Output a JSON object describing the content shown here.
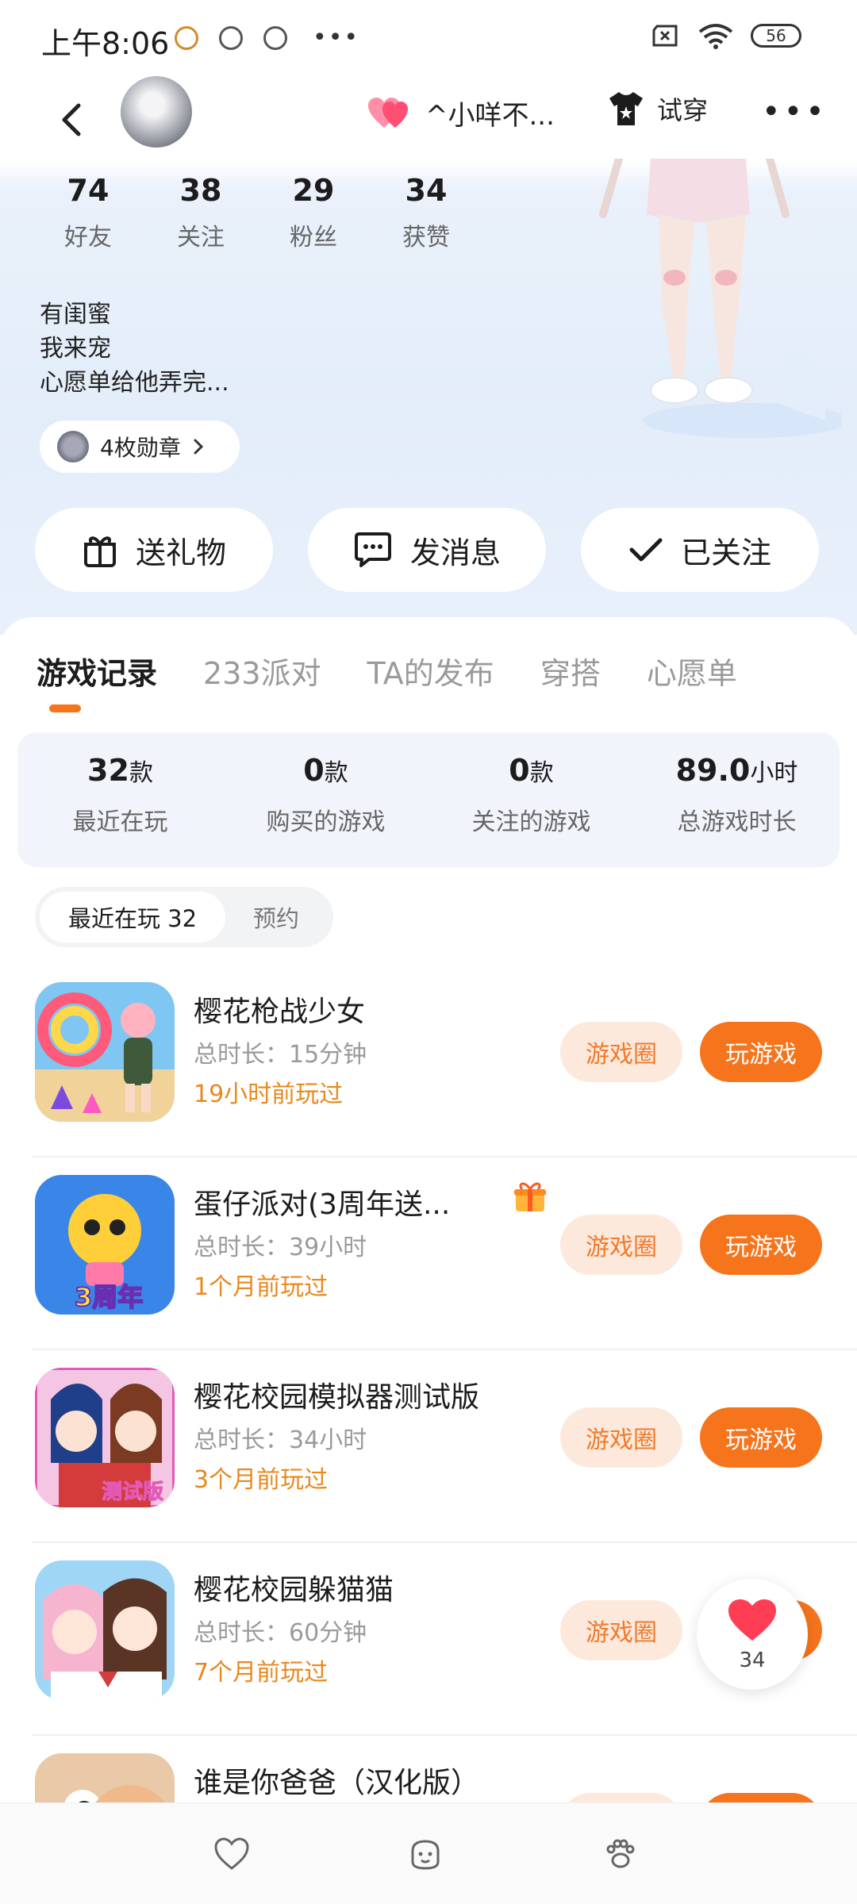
{
  "status_bar": {
    "time": "上午8:06",
    "battery": "56"
  },
  "top_nav": {
    "mate_name": "^小咩不...",
    "tryon_label": "试穿"
  },
  "stats": [
    {
      "num": "74",
      "label": "好友"
    },
    {
      "num": "38",
      "label": "关注"
    },
    {
      "num": "29",
      "label": "粉丝"
    },
    {
      "num": "34",
      "label": "获赞"
    }
  ],
  "bio": {
    "line1": "有闺蜜",
    "line2": "我来宠",
    "line3": "心愿单给他弄完..."
  },
  "badge": {
    "label": "4枚勋章"
  },
  "actions": {
    "gift": "送礼物",
    "message": "发消息",
    "following": "已关注"
  },
  "tabs": [
    "游戏记录",
    "233派对",
    "TA的发布",
    "穿搭",
    "心愿单"
  ],
  "summary": [
    {
      "value": "32",
      "unit": "款",
      "label": "最近在玩"
    },
    {
      "value": "0",
      "unit": "款",
      "label": "购买的游戏"
    },
    {
      "value": "0",
      "unit": "款",
      "label": "关注的游戏"
    },
    {
      "value": "89.0",
      "unit": "小时",
      "label": "总游戏时长"
    }
  ],
  "subtabs": {
    "recent": "最近在玩 32",
    "reserve": "预约"
  },
  "buttons": {
    "circle": "游戏圈",
    "play": "玩游戏"
  },
  "games": [
    {
      "title": "樱花枪战少女",
      "duration": "总时长：15分钟",
      "ago": "19小时前玩过"
    },
    {
      "title": "蛋仔派对(3周年送...",
      "duration": "总时长：39小时",
      "ago": "1个月前玩过",
      "icon_text": "3周年"
    },
    {
      "title": "樱花校园模拟器测试版",
      "duration": "总时长：34小时",
      "ago": "3个月前玩过",
      "icon_text": "测试版"
    },
    {
      "title": "樱花校园躲猫猫",
      "duration": "总时长：60分钟",
      "ago": "7个月前玩过"
    },
    {
      "title": "谁是你爸爸（汉化版）",
      "duration": "",
      "ago": ""
    }
  ],
  "floating_like": {
    "count": "34"
  },
  "colors": {
    "accent": "#f5741c",
    "accent_soft": "#fde9dc",
    "ago": "#e9891d"
  }
}
